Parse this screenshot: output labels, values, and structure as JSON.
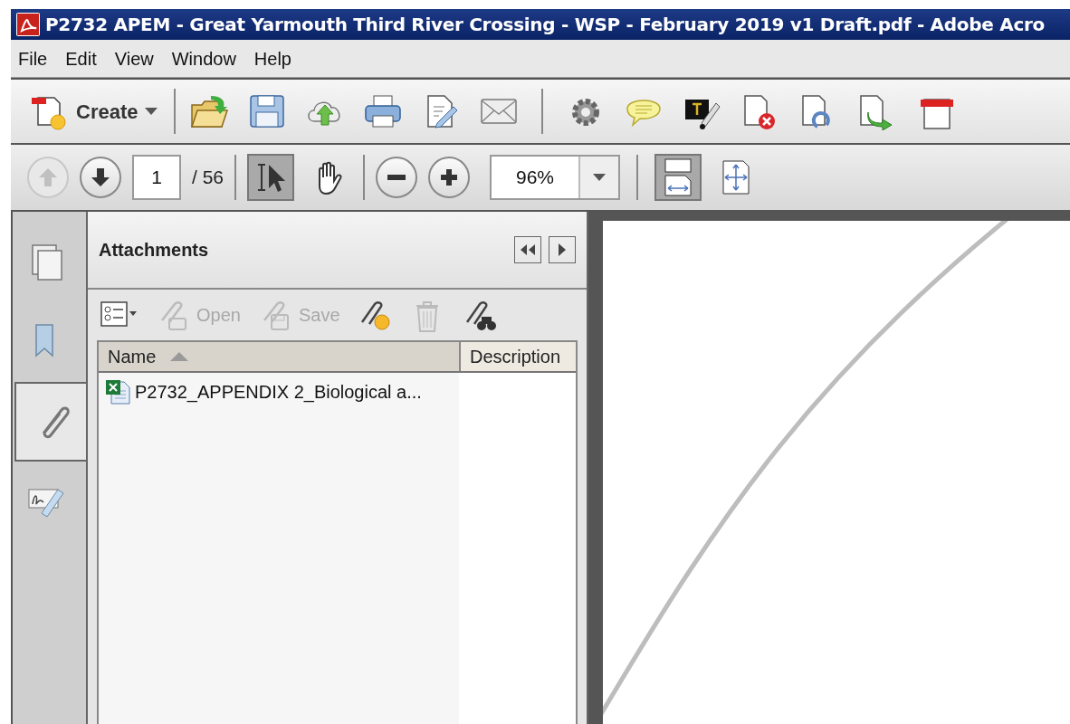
{
  "window": {
    "title": "P2732 APEM - Great Yarmouth Third River Crossing - WSP - February 2019 v1 Draft.pdf - Adobe Acro"
  },
  "menu": [
    "File",
    "Edit",
    "View",
    "Window",
    "Help"
  ],
  "toolbar": {
    "create_label": "Create",
    "tools": [
      {
        "kind": "open"
      },
      {
        "kind": "save"
      },
      {
        "kind": "upload"
      },
      {
        "kind": "print"
      },
      {
        "kind": "edit"
      },
      {
        "kind": "email"
      },
      {
        "kind": "sep"
      },
      {
        "kind": "gear"
      },
      {
        "kind": "comment"
      },
      {
        "kind": "redact"
      },
      {
        "kind": "delete_page"
      },
      {
        "kind": "rotate_page"
      },
      {
        "kind": "extract_page"
      },
      {
        "kind": "partial"
      }
    ]
  },
  "navigation": {
    "buttons": [
      {
        "kind": "up",
        "disabled": true
      },
      {
        "kind": "down",
        "disabled": false
      }
    ],
    "page": "1",
    "total": "/ 56",
    "tools": [
      {
        "kind": "select",
        "selected": true
      },
      {
        "kind": "hand",
        "selected": false
      }
    ],
    "zoom_buttons": [
      {
        "kind": "out"
      },
      {
        "kind": "in"
      }
    ],
    "zoom": "96%",
    "view_buttons": [
      {
        "kind": "fit_width",
        "selected": true
      },
      {
        "kind": "fit_page",
        "selected": false
      }
    ]
  },
  "sidebar_tabs": [
    {
      "kind": "pages",
      "selected": false
    },
    {
      "kind": "bookmarks",
      "selected": false
    },
    {
      "kind": "attachments",
      "selected": true
    },
    {
      "kind": "signatures",
      "selected": false
    }
  ],
  "panel": {
    "title": "Attachments",
    "tools": [
      {
        "kind": "options",
        "disabled": false
      },
      {
        "kind": "open",
        "label": "Open",
        "disabled": true
      },
      {
        "kind": "save",
        "label": "Save",
        "disabled": true
      },
      {
        "kind": "add",
        "disabled": false
      },
      {
        "kind": "delete",
        "disabled": true
      },
      {
        "kind": "search",
        "disabled": false
      }
    ],
    "columns": [
      {
        "label": "Name",
        "sorted": true
      },
      {
        "label": "Description",
        "sorted": false
      }
    ],
    "rows": [
      {
        "name": "P2732_APPENDIX 2_Biological a..."
      }
    ]
  }
}
